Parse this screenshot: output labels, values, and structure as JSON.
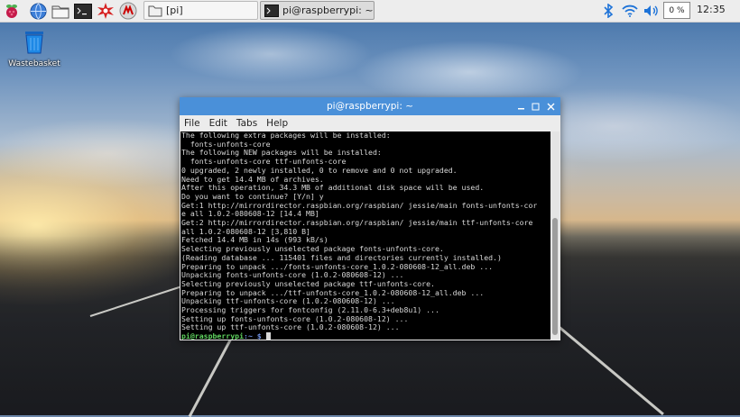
{
  "taskbar": {
    "launchers": [
      {
        "name": "raspberry-menu-icon"
      },
      {
        "name": "web-browser-icon"
      },
      {
        "name": "file-manager-icon"
      },
      {
        "name": "terminal-icon"
      },
      {
        "name": "math-kernel-icon"
      },
      {
        "name": "wolfram-icon"
      }
    ],
    "tasks": [
      {
        "label": "[pi]",
        "icon": "folder-icon"
      },
      {
        "label": "pi@raspberrypi: ~",
        "icon": "terminal-icon",
        "active": true
      }
    ],
    "cpu": "0 %",
    "clock": "12:35"
  },
  "desktop": {
    "wastebasket_label": "Wastebasket"
  },
  "terminal": {
    "title": "pi@raspberrypi: ~",
    "menu": [
      "File",
      "Edit",
      "Tabs",
      "Help"
    ],
    "lines": [
      "The following extra packages will be installed:",
      "  fonts-unfonts-core",
      "The following NEW packages will be installed:",
      "  fonts-unfonts-core ttf-unfonts-core",
      "0 upgraded, 2 newly installed, 0 to remove and 0 not upgraded.",
      "Need to get 14.4 MB of archives.",
      "After this operation, 34.3 MB of additional disk space will be used.",
      "Do you want to continue? [Y/n] y",
      "Get:1 http://mirrordirector.raspbian.org/raspbian/ jessie/main fonts-unfonts-cor",
      "e all 1.0.2-080608-12 [14.4 MB]",
      "Get:2 http://mirrordirector.raspbian.org/raspbian/ jessie/main ttf-unfonts-core",
      "all 1.0.2-080608-12 [3,810 B]",
      "Fetched 14.4 MB in 14s (993 kB/s)",
      "Selecting previously unselected package fonts-unfonts-core.",
      "(Reading database ... 115401 files and directories currently installed.)",
      "Preparing to unpack .../fonts-unfonts-core_1.0.2-080608-12_all.deb ...",
      "Unpacking fonts-unfonts-core (1.0.2-080608-12) ...",
      "Selecting previously unselected package ttf-unfonts-core.",
      "Preparing to unpack .../ttf-unfonts-core_1.0.2-080608-12_all.deb ...",
      "Unpacking ttf-unfonts-core (1.0.2-080608-12) ...",
      "Processing triggers for fontconfig (2.11.0-6.3+deb8u1) ...",
      "Setting up fonts-unfonts-core (1.0.2-080608-12) ...",
      "Setting up ttf-unfonts-core (1.0.2-080608-12) ..."
    ],
    "prompt_user": "pi@raspberrypi",
    "prompt_path": ":~ $"
  }
}
